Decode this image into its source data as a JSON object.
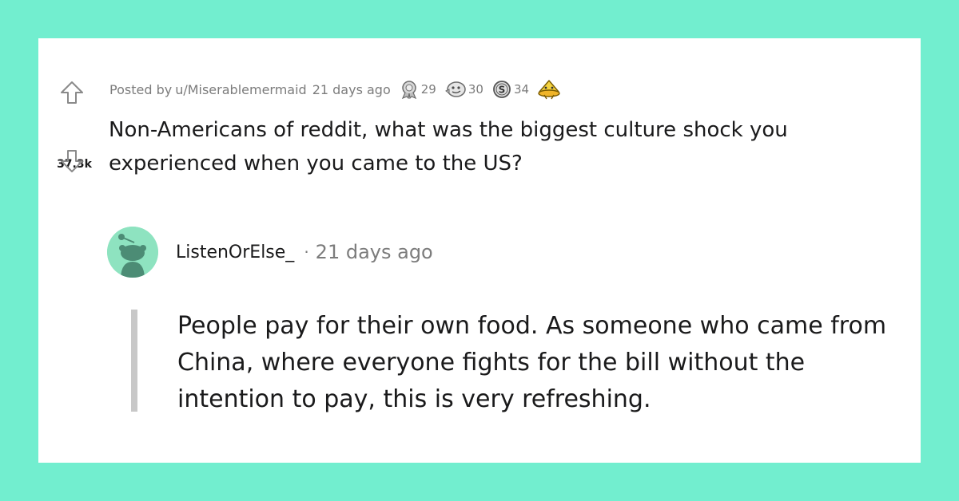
{
  "post": {
    "score": "37.3k",
    "posted_by_prefix": "Posted by",
    "author": "u/Miserablemermaid",
    "age": "21 days ago",
    "awards": [
      {
        "icon": "silver-award-icon",
        "count": "29"
      },
      {
        "icon": "helpful-award-icon",
        "count": "30"
      },
      {
        "icon": "coin-award-icon",
        "count": "34"
      },
      {
        "icon": "gold-hat-award-icon",
        "count": ""
      }
    ],
    "title": "Non-Americans of reddit, what was the biggest culture shock you experienced when you came to the US?"
  },
  "comment": {
    "username": "ListenOrElse_",
    "separator": "·",
    "age": "21 days ago",
    "body": "People pay for their own food. As someone who came from China, where everyone fights for the bill without the intention to pay, this is very refreshing."
  },
  "colors": {
    "background": "#72eecf",
    "card": "#ffffff",
    "text": "#1a1a1b",
    "meta_text": "#7c7c7c",
    "avatar_bg": "#8ee3c0",
    "avatar_figure": "#4c8c75",
    "thread_line": "#c8c8c8"
  }
}
